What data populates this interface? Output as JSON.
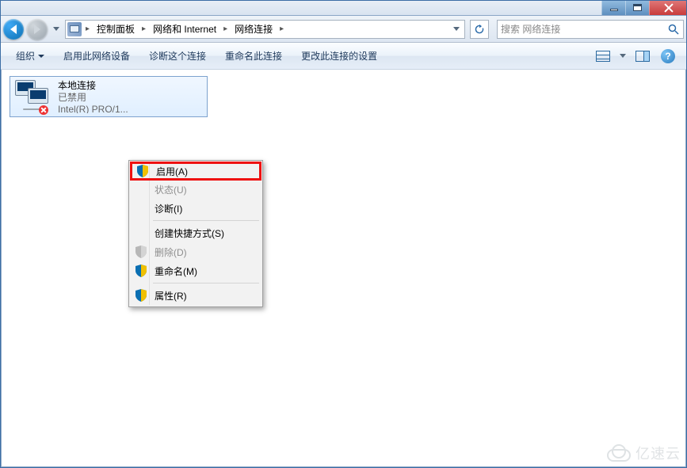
{
  "titlebar": {
    "min": "",
    "max": "",
    "close": ""
  },
  "nav": {
    "breadcrumb": {
      "root": "控制面板",
      "l2": "网络和 Internet",
      "l3": "网络连接"
    },
    "search_placeholder": "搜索 网络连接"
  },
  "toolbar": {
    "organize": "组织",
    "enable_device": "启用此网络设备",
    "diagnose": "诊断这个连接",
    "rename": "重命名此连接",
    "change_settings": "更改此连接的设置"
  },
  "connection": {
    "name": "本地连接",
    "status": "已禁用",
    "device": "Intel(R) PRO/1..."
  },
  "context_menu": {
    "enable": "启用(A)",
    "status": "状态(U)",
    "diagnose": "诊断(I)",
    "create_shortcut": "创建快捷方式(S)",
    "delete": "删除(D)",
    "rename": "重命名(M)",
    "properties": "属性(R)"
  },
  "watermark": "亿速云"
}
